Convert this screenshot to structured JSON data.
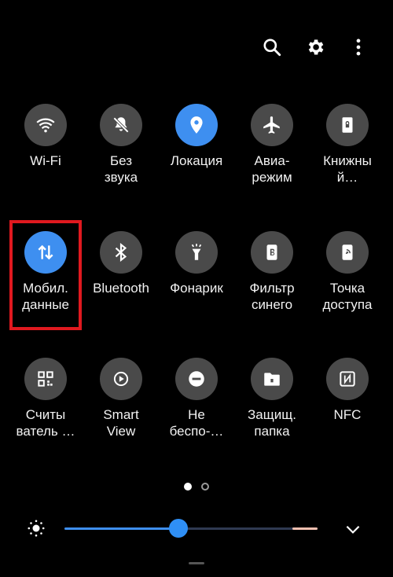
{
  "header": {
    "icons": [
      "search-icon",
      "gear-icon",
      "more-vert-icon"
    ]
  },
  "tiles": [
    {
      "label": "Wi-Fi",
      "icon": "wifi-icon",
      "active": false
    },
    {
      "label": "Без\nзвука",
      "icon": "mute-icon",
      "active": false
    },
    {
      "label": "Локация",
      "icon": "location-icon",
      "active": true
    },
    {
      "label": "Авиа-\nрежим",
      "icon": "airplane-icon",
      "active": false
    },
    {
      "label": "Книжны\nй…",
      "icon": "book-lock-icon",
      "active": false
    },
    {
      "label": "Мобил.\nданные",
      "icon": "mobile-data-icon",
      "active": true
    },
    {
      "label": "Bluetooth",
      "icon": "bluetooth-icon",
      "active": false
    },
    {
      "label": "Фонарик",
      "icon": "flashlight-icon",
      "active": false
    },
    {
      "label": "Фильтр\nсинего",
      "icon": "blue-filter-icon",
      "active": false
    },
    {
      "label": "Точка\nдоступа",
      "icon": "hotspot-icon",
      "active": false
    },
    {
      "label": "Считы\nватель …",
      "icon": "qr-icon",
      "active": false
    },
    {
      "label": "Smart\nView",
      "icon": "smart-view-icon",
      "active": false
    },
    {
      "label": "Не\nбеспо-…",
      "icon": "dnd-icon",
      "active": false
    },
    {
      "label": "Защищ.\nпапка",
      "icon": "secure-folder-icon",
      "active": false
    },
    {
      "label": "NFC",
      "icon": "nfc-icon",
      "active": false
    }
  ],
  "pager": {
    "pages": 2,
    "current": 1
  },
  "brightness": {
    "level": 0.45
  },
  "colors": {
    "accent": "#3e8ff0",
    "tile_bg": "#4a4a4a",
    "highlight": "#e0191f",
    "background": "#000000"
  }
}
